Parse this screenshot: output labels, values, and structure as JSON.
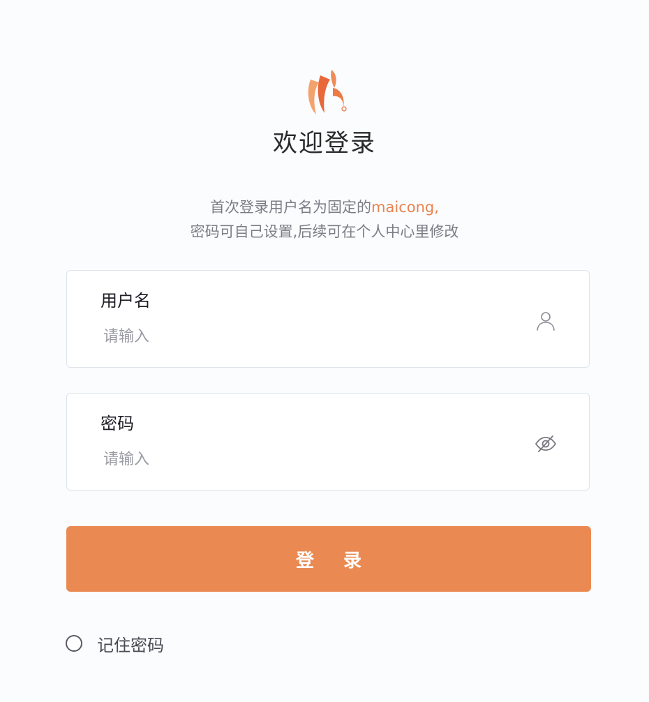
{
  "header": {
    "title": "欢迎登录",
    "subtitle_line1_prefix": "首次登录用户名为固定的",
    "subtitle_line1_brand": "maicong",
    "subtitle_line1_suffix": ",",
    "subtitle_line2": "密码可自己设置,后续可在个人中心里修改"
  },
  "form": {
    "username": {
      "label": "用户名",
      "value": "",
      "placeholder": "请输入",
      "icon": "user-icon"
    },
    "password": {
      "label": "密码",
      "value": "",
      "placeholder": "请输入",
      "icon": "eye-off-icon"
    },
    "submit_label": "登录",
    "remember": {
      "label": "记住密码",
      "checked": false
    }
  },
  "colors": {
    "accent": "#ea8a52",
    "logo_light": "#f4a26c",
    "logo_dark": "#e8683a",
    "background": "#fbfcfe"
  }
}
